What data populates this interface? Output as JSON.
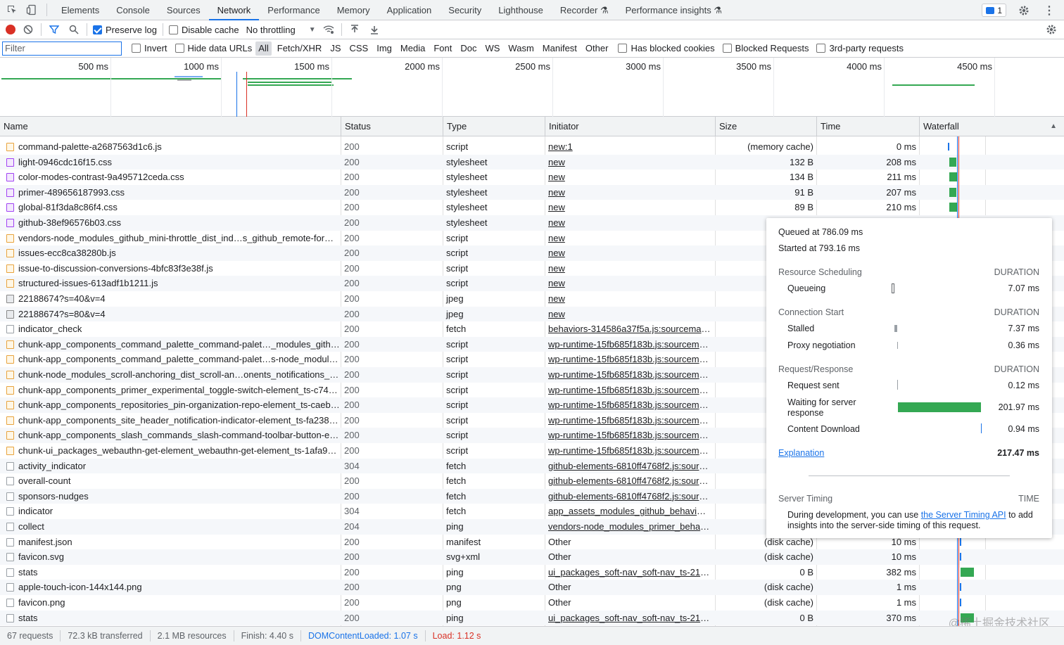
{
  "devtools_tabs": [
    "Elements",
    "Console",
    "Sources",
    "Network",
    "Performance",
    "Memory",
    "Application",
    "Security",
    "Lighthouse",
    "Recorder ⚗",
    "Performance insights ⚗"
  ],
  "active_tab": "Network",
  "issues_count": "1",
  "toolbar": {
    "preserve_log": "Preserve log",
    "disable_cache": "Disable cache",
    "throttling": "No throttling"
  },
  "filter": {
    "placeholder": "Filter",
    "invert": "Invert",
    "hide_data_urls": "Hide data URLs",
    "types": [
      "All",
      "Fetch/XHR",
      "JS",
      "CSS",
      "Img",
      "Media",
      "Font",
      "Doc",
      "WS",
      "Wasm",
      "Manifest",
      "Other"
    ],
    "has_blocked_cookies": "Has blocked cookies",
    "blocked_requests": "Blocked Requests",
    "third_party": "3rd-party requests"
  },
  "overview_ticks": [
    "500 ms",
    "1000 ms",
    "1500 ms",
    "2000 ms",
    "2500 ms",
    "3000 ms",
    "3500 ms",
    "4000 ms",
    "4500 ms"
  ],
  "columns": {
    "name": "Name",
    "status": "Status",
    "type": "Type",
    "initiator": "Initiator",
    "size": "Size",
    "time": "Time",
    "waterfall": "Waterfall"
  },
  "rows": [
    {
      "name": "command-palette-a2687563d1c6.js",
      "icon": "script",
      "status": "200",
      "type": "script",
      "initiator": "new:1",
      "size": "(memory cache)",
      "time": "0 ms"
    },
    {
      "name": "light-0946cdc16f15.css",
      "icon": "css",
      "status": "200",
      "type": "stylesheet",
      "initiator": "new",
      "size": "132 B",
      "time": "208 ms"
    },
    {
      "name": "color-modes-contrast-9a495712ceda.css",
      "icon": "css",
      "status": "200",
      "type": "stylesheet",
      "initiator": "new",
      "size": "134 B",
      "time": "211 ms"
    },
    {
      "name": "primer-489656187993.css",
      "icon": "css",
      "status": "200",
      "type": "stylesheet",
      "initiator": "new",
      "size": "91 B",
      "time": "207 ms"
    },
    {
      "name": "global-81f3da8c86f4.css",
      "icon": "css",
      "status": "200",
      "type": "stylesheet",
      "initiator": "new",
      "size": "89 B",
      "time": "210 ms"
    },
    {
      "name": "github-38ef96576b03.css",
      "icon": "css",
      "status": "200",
      "type": "stylesheet",
      "initiator": "new",
      "size": "",
      "time": ""
    },
    {
      "name": "vendors-node_modules_github_mini-throttle_dist_ind…s_github_remote-form_…",
      "icon": "script",
      "status": "200",
      "type": "script",
      "initiator": "new",
      "size": "",
      "time": ""
    },
    {
      "name": "issues-ecc8ca38280b.js",
      "icon": "script",
      "status": "200",
      "type": "script",
      "initiator": "new",
      "size": "",
      "time": ""
    },
    {
      "name": "issue-to-discussion-conversions-4bfc83f3e38f.js",
      "icon": "script",
      "status": "200",
      "type": "script",
      "initiator": "new",
      "size": "",
      "time": ""
    },
    {
      "name": "structured-issues-613adf1b1211.js",
      "icon": "script",
      "status": "200",
      "type": "script",
      "initiator": "new",
      "size": "",
      "time": ""
    },
    {
      "name": "22188674?s=40&v=4",
      "icon": "img",
      "status": "200",
      "type": "jpeg",
      "initiator": "new",
      "size": "(me",
      "time": ""
    },
    {
      "name": "22188674?s=80&v=4",
      "icon": "img",
      "status": "200",
      "type": "jpeg",
      "initiator": "new",
      "size": "(me",
      "time": ""
    },
    {
      "name": "indicator_check",
      "icon": "doc",
      "status": "200",
      "type": "fetch",
      "initiator": "behaviors-314586a37f5a.js:sourcemap:8",
      "size": "",
      "time": ""
    },
    {
      "name": "chunk-app_components_command_palette_command-palet…_modules_githu…",
      "icon": "script",
      "status": "200",
      "type": "script",
      "initiator": "wp-runtime-15fb685f183b.js:sourcema…",
      "size": "",
      "time": ""
    },
    {
      "name": "chunk-app_components_command_palette_command-palet…s-node_modules…",
      "icon": "script",
      "status": "200",
      "type": "script",
      "initiator": "wp-runtime-15fb685f183b.js:sourcema…",
      "size": "",
      "time": ""
    },
    {
      "name": "chunk-node_modules_scroll-anchoring_dist_scroll-an…onents_notifications_no…",
      "icon": "script",
      "status": "200",
      "type": "script",
      "initiator": "wp-runtime-15fb685f183b.js:sourcema…",
      "size": "",
      "time": ""
    },
    {
      "name": "chunk-app_components_primer_experimental_toggle-switch-element_ts-c749d…",
      "icon": "script",
      "status": "200",
      "type": "script",
      "initiator": "wp-runtime-15fb685f183b.js:sourcema…",
      "size": "",
      "time": ""
    },
    {
      "name": "chunk-app_components_repositories_pin-organization-repo-element_ts-caebd…",
      "icon": "script",
      "status": "200",
      "type": "script",
      "initiator": "wp-runtime-15fb685f183b.js:sourcema…",
      "size": "",
      "time": ""
    },
    {
      "name": "chunk-app_components_site_header_notification-indicator-element_ts-fa238d7…",
      "icon": "script",
      "status": "200",
      "type": "script",
      "initiator": "wp-runtime-15fb685f183b.js:sourcema…",
      "size": "",
      "time": ""
    },
    {
      "name": "chunk-app_components_slash_commands_slash-command-toolbar-button-ele…",
      "icon": "script",
      "status": "200",
      "type": "script",
      "initiator": "wp-runtime-15fb685f183b.js:sourcema…",
      "size": "",
      "time": ""
    },
    {
      "name": "chunk-ui_packages_webauthn-get-element_webauthn-get-element_ts-1afa9dfc…",
      "icon": "script",
      "status": "200",
      "type": "script",
      "initiator": "wp-runtime-15fb685f183b.js:sourcema…",
      "size": "",
      "time": ""
    },
    {
      "name": "activity_indicator",
      "icon": "doc",
      "status": "304",
      "type": "fetch",
      "initiator": "github-elements-6810ff4768f2.js:sourc…",
      "size": "",
      "time": ""
    },
    {
      "name": "overall-count",
      "icon": "doc",
      "status": "200",
      "type": "fetch",
      "initiator": "github-elements-6810ff4768f2.js:sourc…",
      "size": "",
      "time": ""
    },
    {
      "name": "sponsors-nudges",
      "icon": "doc",
      "status": "200",
      "type": "fetch",
      "initiator": "github-elements-6810ff4768f2.js:sourc…",
      "size": "",
      "time": ""
    },
    {
      "name": "indicator",
      "icon": "doc",
      "status": "304",
      "type": "fetch",
      "initiator": "app_assets_modules_github_behaviors…",
      "size": "",
      "time": ""
    },
    {
      "name": "collect",
      "icon": "doc",
      "status": "204",
      "type": "ping",
      "initiator": "vendors-node_modules_primer_behavi…",
      "size": "",
      "time": ""
    },
    {
      "name": "manifest.json",
      "icon": "doc",
      "status": "200",
      "type": "manifest",
      "initiator": "Other",
      "size": "(disk cache)",
      "time": "10 ms"
    },
    {
      "name": "favicon.svg",
      "icon": "doc",
      "status": "200",
      "type": "svg+xml",
      "initiator": "Other",
      "size": "(disk cache)",
      "time": "10 ms"
    },
    {
      "name": "stats",
      "icon": "doc",
      "status": "200",
      "type": "ping",
      "initiator": "ui_packages_soft-nav_soft-nav_ts-21fc…",
      "size": "0 B",
      "time": "382 ms"
    },
    {
      "name": "apple-touch-icon-144x144.png",
      "icon": "doc",
      "status": "200",
      "type": "png",
      "initiator": "Other",
      "size": "(disk cache)",
      "time": "1 ms"
    },
    {
      "name": "favicon.png",
      "icon": "doc",
      "status": "200",
      "type": "png",
      "initiator": "Other",
      "size": "(disk cache)",
      "time": "1 ms"
    },
    {
      "name": "stats",
      "icon": "doc",
      "status": "200",
      "type": "ping",
      "initiator": "ui_packages_soft-nav_soft-nav_ts-21fc…",
      "size": "0 B",
      "time": "370 ms"
    }
  ],
  "tooltip": {
    "queued": "Queued at 786.09 ms",
    "started": "Started at 793.16 ms",
    "resource_scheduling": "Resource Scheduling",
    "duration_label": "DURATION",
    "queueing": "Queueing",
    "queueing_val": "7.07 ms",
    "connection_start": "Connection Start",
    "stalled": "Stalled",
    "stalled_val": "7.37 ms",
    "proxy": "Proxy negotiation",
    "proxy_val": "0.36 ms",
    "request_response": "Request/Response",
    "request_sent": "Request sent",
    "request_sent_val": "0.12 ms",
    "waiting_1": "Waiting for server",
    "waiting_2": "response",
    "waiting_val": "201.97 ms",
    "download": "Content Download",
    "download_val": "0.94 ms",
    "explanation": "Explanation",
    "total": "217.47 ms",
    "server_timing": "Server Timing",
    "time_label": "TIME",
    "st_text_1": "During development, you can use ",
    "st_link": "the Server Timing API",
    "st_text_2": " to add",
    "st_text_3": "insights into the server-side timing of this request."
  },
  "statusbar": {
    "requests": "67 requests",
    "transferred": "72.3 kB transferred",
    "resources": "2.1 MB resources",
    "finish": "Finish: 4.40 s",
    "dcl": "DOMContentLoaded: 1.07 s",
    "load": "Load: 1.12 s"
  },
  "watermark": "@稀土掘金技术社区",
  "colors": {
    "accent": "#1a73e8",
    "record": "#d93025",
    "waiting": "#34a853"
  }
}
